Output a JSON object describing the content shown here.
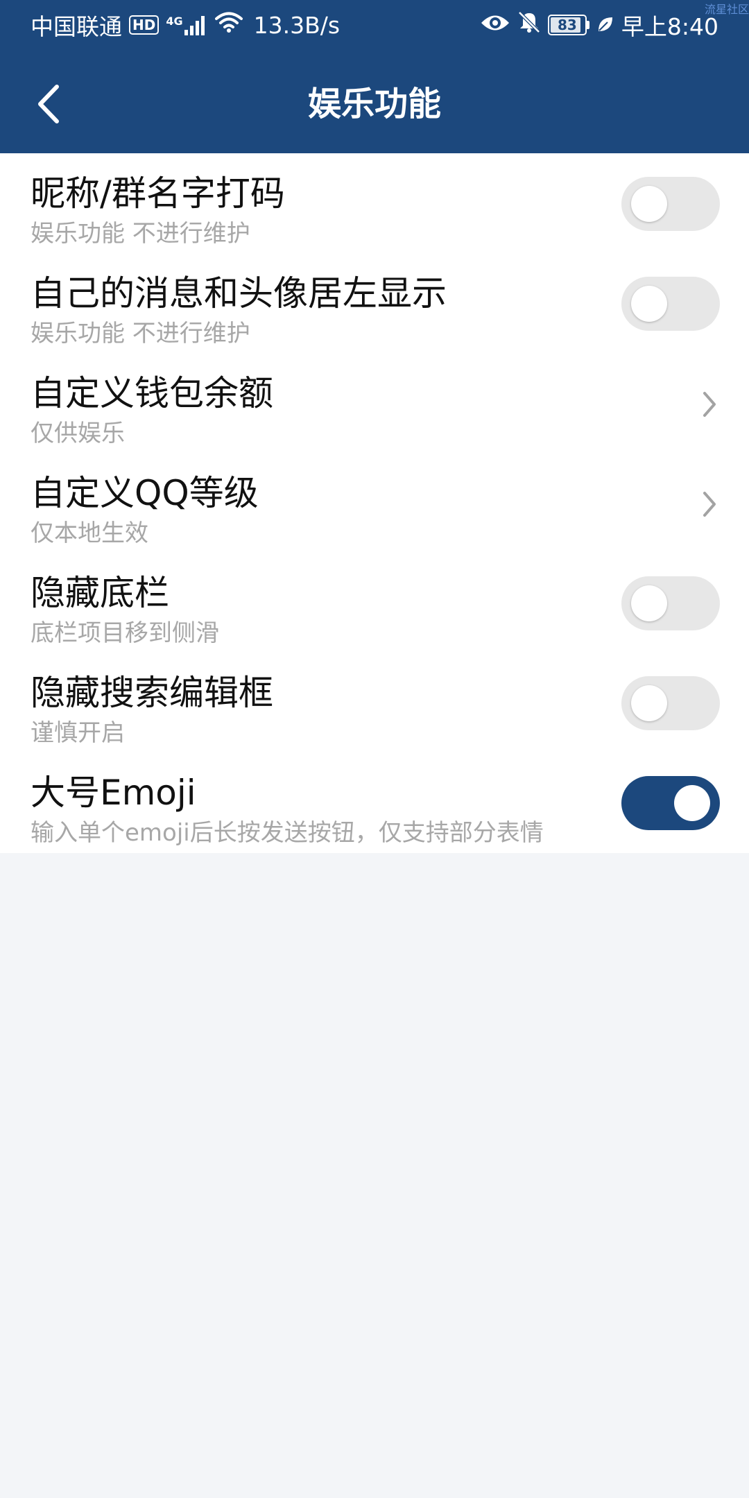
{
  "status_bar": {
    "carrier": "中国联通",
    "hd": "HD",
    "network": "4G",
    "speed": "13.3B/s",
    "battery": "83",
    "time": "早上8:40",
    "watermark": "流星社区"
  },
  "header": {
    "title": "娱乐功能"
  },
  "settings": [
    {
      "title": "昵称/群名字打码",
      "subtitle": "娱乐功能 不进行维护",
      "control": "toggle",
      "on": false
    },
    {
      "title": "自己的消息和头像居左显示",
      "subtitle": "娱乐功能 不进行维护",
      "control": "toggle",
      "on": false
    },
    {
      "title": "自定义钱包余额",
      "subtitle": "仅供娱乐",
      "control": "chevron"
    },
    {
      "title": "自定义QQ等级",
      "subtitle": "仅本地生效",
      "control": "chevron"
    },
    {
      "title": "隐藏底栏",
      "subtitle": "底栏项目移到侧滑",
      "control": "toggle",
      "on": false
    },
    {
      "title": "隐藏搜索编辑框",
      "subtitle": "谨慎开启",
      "control": "toggle",
      "on": false
    },
    {
      "title": "大号Emoji",
      "subtitle": "输入单个emoji后长按发送按钮，仅支持部分表情",
      "control": "toggle",
      "on": true
    }
  ],
  "colors": {
    "primary": "#1c487d",
    "toggle_off": "#e7e7e7",
    "subtitle": "#a7a7a7",
    "background": "#f3f5f8"
  }
}
